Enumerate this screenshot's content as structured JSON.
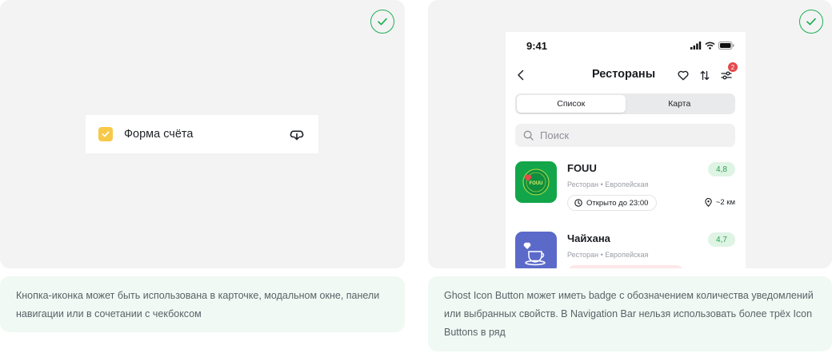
{
  "colors": {
    "success": "#1fae52",
    "checkbox": "#f7c948",
    "rating_bg": "#dff4e4",
    "rating_text": "#2aa24e",
    "badge": "#e5484d",
    "note_bg": "#f0f9f3"
  },
  "left_example": {
    "checkbox_label": "Форма счёта",
    "checkbox_checked": true,
    "icon": "download-icon"
  },
  "right_example": {
    "status_time": "9:41",
    "nav_title": "Рестораны",
    "nav_badge": "2",
    "tabs": [
      {
        "label": "Список",
        "active": true
      },
      {
        "label": "Карта",
        "active": false
      }
    ],
    "search_placeholder": "Поиск",
    "restaurants": [
      {
        "name": "FOUU",
        "category": "Ресторан • Европейская",
        "rating": "4,8",
        "hours": "Открыто до 23:00",
        "distance": "~2 км",
        "logo_text": "FOUU"
      },
      {
        "name": "Чайхана",
        "category": "Ресторан • Европейская",
        "rating": "4,7"
      }
    ]
  },
  "notes": {
    "left": "Кнопка-иконка может быть использована в карточке, модальном окне, панели навигации или в сочетании с чекбоксом",
    "right": "Ghost Icon Button может иметь badge с обозначением количества уведомлений или выбранных свойств. В Navigation Bar нельзя использовать более трёх Icon Buttons в ряд"
  }
}
